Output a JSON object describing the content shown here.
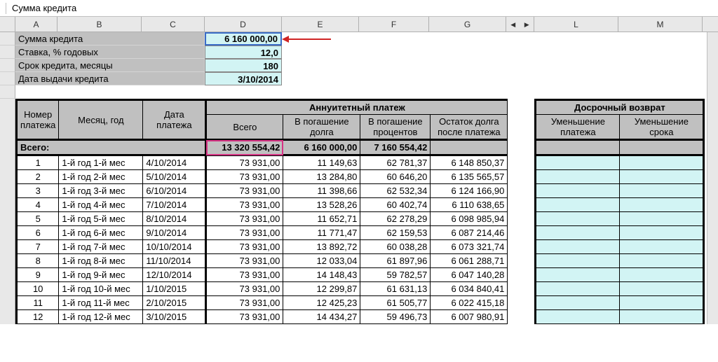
{
  "formulaBar": "Сумма кредита",
  "cols": [
    "A",
    "B",
    "C",
    "D",
    "E",
    "F",
    "G",
    "L",
    "M"
  ],
  "params": [
    {
      "label": "Сумма кредита",
      "value": "6 160 000,00",
      "selected": true,
      "arrow": true
    },
    {
      "label": "Ставка, % годовых",
      "value": "12,0"
    },
    {
      "label": "Срок кредита, месяцы",
      "value": "180"
    },
    {
      "label": "Дата выдачи кредита",
      "value": "3/10/2014"
    }
  ],
  "headers": {
    "num": "Номер платежа",
    "month": "Месяц, год",
    "date": "Дата платежа",
    "sectionAnn": "Аннуитетный платеж",
    "sectionEarly": "Досрочный возврат",
    "total": "Всего",
    "principal": "В погашение долга",
    "interest": "В погашение процентов",
    "balance": "Остаток долга после платежа",
    "reducePay": "Уменьшение платежа",
    "reduceTerm": "Уменьшение срока"
  },
  "totalsLabel": "Всего:",
  "totals": {
    "total": "13 320 554,42",
    "principal": "6 160 000,00",
    "interest": "7 160 554,42"
  },
  "rows": [
    {
      "n": "1",
      "m": "1-й год 1-й мес",
      "d": "4/10/2014",
      "t": "73 931,00",
      "p": "11 149,63",
      "i": "62 781,37",
      "b": "6 148 850,37"
    },
    {
      "n": "2",
      "m": "1-й год 2-й мес",
      "d": "5/10/2014",
      "t": "73 931,00",
      "p": "13 284,80",
      "i": "60 646,20",
      "b": "6 135 565,57"
    },
    {
      "n": "3",
      "m": "1-й год 3-й мес",
      "d": "6/10/2014",
      "t": "73 931,00",
      "p": "11 398,66",
      "i": "62 532,34",
      "b": "6 124 166,90"
    },
    {
      "n": "4",
      "m": "1-й год 4-й мес",
      "d": "7/10/2014",
      "t": "73 931,00",
      "p": "13 528,26",
      "i": "60 402,74",
      "b": "6 110 638,65"
    },
    {
      "n": "5",
      "m": "1-й год 5-й мес",
      "d": "8/10/2014",
      "t": "73 931,00",
      "p": "11 652,71",
      "i": "62 278,29",
      "b": "6 098 985,94"
    },
    {
      "n": "6",
      "m": "1-й год 6-й мес",
      "d": "9/10/2014",
      "t": "73 931,00",
      "p": "11 771,47",
      "i": "62 159,53",
      "b": "6 087 214,46"
    },
    {
      "n": "7",
      "m": "1-й год 7-й мес",
      "d": "10/10/2014",
      "t": "73 931,00",
      "p": "13 892,72",
      "i": "60 038,28",
      "b": "6 073 321,74"
    },
    {
      "n": "8",
      "m": "1-й год 8-й мес",
      "d": "11/10/2014",
      "t": "73 931,00",
      "p": "12 033,04",
      "i": "61 897,96",
      "b": "6 061 288,71"
    },
    {
      "n": "9",
      "m": "1-й год 9-й мес",
      "d": "12/10/2014",
      "t": "73 931,00",
      "p": "14 148,43",
      "i": "59 782,57",
      "b": "6 047 140,28"
    },
    {
      "n": "10",
      "m": "1-й год 10-й мес",
      "d": "1/10/2015",
      "t": "73 931,00",
      "p": "12 299,87",
      "i": "61 631,13",
      "b": "6 034 840,41",
      "hover": true
    },
    {
      "n": "11",
      "m": "1-й год 11-й мес",
      "d": "2/10/2015",
      "t": "73 931,00",
      "p": "12 425,23",
      "i": "61 505,77",
      "b": "6 022 415,18"
    },
    {
      "n": "12",
      "m": "1-й год 12-й мес",
      "d": "3/10/2015",
      "t": "73 931,00",
      "p": "14 434,27",
      "i": "59 496,73",
      "b": "6 007 980,91"
    }
  ]
}
